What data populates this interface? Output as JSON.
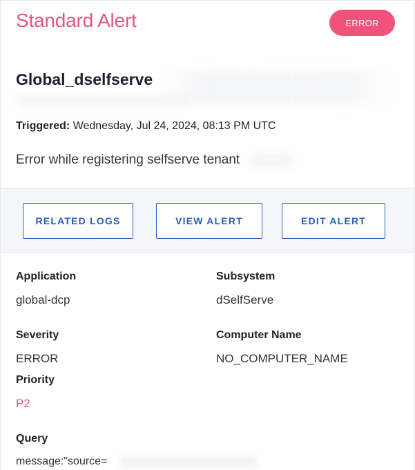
{
  "header": {
    "title": "Standard Alert",
    "badge": "ERROR"
  },
  "alert": {
    "name": "Global_dselfserve",
    "triggered_label": "Triggered:",
    "triggered_value": "Wednesday, Jul 24, 2024, 08:13 PM UTC",
    "message": "Error while registering selfserve tenant"
  },
  "actions": {
    "related_logs": "RELATED LOGS",
    "view_alert": "VIEW ALERT",
    "edit_alert": "EDIT ALERT"
  },
  "details": {
    "application_label": "Application",
    "application_value": "global-dcp",
    "subsystem_label": "Subsystem",
    "subsystem_value": "dSelfServe",
    "severity_label": "Severity",
    "severity_value": "ERROR",
    "computer_label": "Computer Name",
    "computer_value": "NO_COMPUTER_NAME",
    "priority_label": "Priority",
    "priority_value": "P2",
    "query_label": "Query",
    "query_value": "message:\"source="
  },
  "colors": {
    "accent": "#e8547a",
    "badge": "#f0527a",
    "button": "#2a5bb8"
  }
}
